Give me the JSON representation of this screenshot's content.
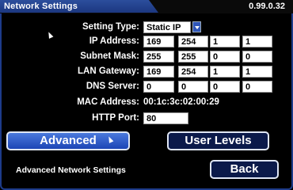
{
  "window": {
    "title": "Network Settings",
    "version": "0.99.0.32"
  },
  "form": {
    "setting_type": {
      "label": "Setting Type:",
      "value": "Static IP"
    },
    "ip_address": {
      "label": "IP Address:",
      "octets": [
        "169",
        "254",
        "1",
        "1"
      ]
    },
    "subnet_mask": {
      "label": "Subnet Mask:",
      "octets": [
        "255",
        "255",
        "0",
        "0"
      ]
    },
    "lan_gateway": {
      "label": "LAN Gateway:",
      "octets": [
        "169",
        "254",
        "1",
        "1"
      ]
    },
    "dns_server": {
      "label": "DNS Server:",
      "octets": [
        "0",
        "0",
        "0",
        "0"
      ]
    },
    "mac_address": {
      "label": "MAC Address:",
      "value": "00:1c:3c:02:00:29"
    },
    "http_port": {
      "label": "HTTP Port:",
      "value": "80"
    }
  },
  "buttons": {
    "advanced": "Advanced",
    "user_levels": "User Levels",
    "back": "Back"
  },
  "footnote": "Advanced Network Settings",
  "colors": {
    "title_bar": "#2c4e9c",
    "panel_border": "#1d3b8a",
    "button_primary": "#2f5fd0",
    "button_dark": "#0b1a4a"
  },
  "icons": {
    "setting_type_dropdown": "chevron-down-icon",
    "pointer": "mouse-cursor-icon"
  }
}
